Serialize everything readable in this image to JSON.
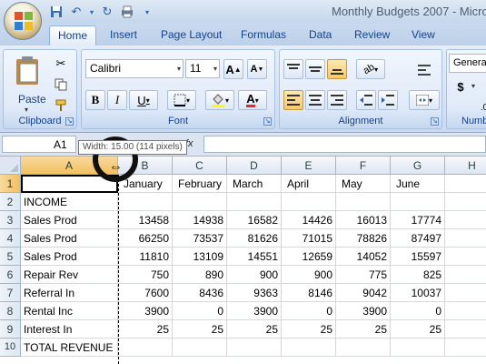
{
  "window": {
    "title": "Monthly Budgets 2007 - Micro"
  },
  "tabs": [
    {
      "label": "Home",
      "active": true
    },
    {
      "label": "Insert"
    },
    {
      "label": "Page Layout"
    },
    {
      "label": "Formulas"
    },
    {
      "label": "Data"
    },
    {
      "label": "Review"
    },
    {
      "label": "View"
    }
  ],
  "ribbon": {
    "clipboard": {
      "label": "Clipboard",
      "paste_label": "Paste"
    },
    "font": {
      "label": "Font",
      "font_name": "Calibri",
      "font_size": "11"
    },
    "alignment": {
      "label": "Alignment"
    },
    "number": {
      "label": "Numb",
      "format": "General",
      "currency": "$"
    }
  },
  "formula_bar": {
    "name_box": "A1",
    "fx": "fx",
    "tooltip": "Width: 15.00 (114 pixels)"
  },
  "grid": {
    "columns": [
      "A",
      "B",
      "C",
      "D",
      "E",
      "F",
      "G",
      "H"
    ],
    "rows": [
      "1",
      "2",
      "3",
      "4",
      "5",
      "6",
      "7",
      "8",
      "9",
      "10"
    ],
    "cells": {
      "r1": [
        "",
        "January",
        "February",
        "March",
        "April",
        "May",
        "June"
      ],
      "r2": [
        "INCOME"
      ],
      "r3": [
        "Sales Prod",
        "13458",
        "14938",
        "16582",
        "14426",
        "16013",
        "17774"
      ],
      "r4": [
        "Sales Prod",
        "66250",
        "73537",
        "81626",
        "71015",
        "78826",
        "87497"
      ],
      "r5": [
        "Sales Prod",
        "11810",
        "13109",
        "14551",
        "12659",
        "14052",
        "15597"
      ],
      "r6": [
        "Repair Rev",
        "750",
        "890",
        "900",
        "900",
        "775",
        "825"
      ],
      "r7": [
        "Referral In",
        "7600",
        "8436",
        "9363",
        "8146",
        "9042",
        "10037"
      ],
      "r8": [
        "Rental Inc",
        "3900",
        "0",
        "3900",
        "0",
        "3900",
        "0"
      ],
      "r9": [
        "Interest In",
        "25",
        "25",
        "25",
        "25",
        "25",
        "25"
      ],
      "r10": [
        "TOTAL REVENUE"
      ]
    }
  },
  "colors": {
    "accent": "#15428b",
    "selected_header": "#f1c15f",
    "ribbon": "#dfe9f8"
  }
}
